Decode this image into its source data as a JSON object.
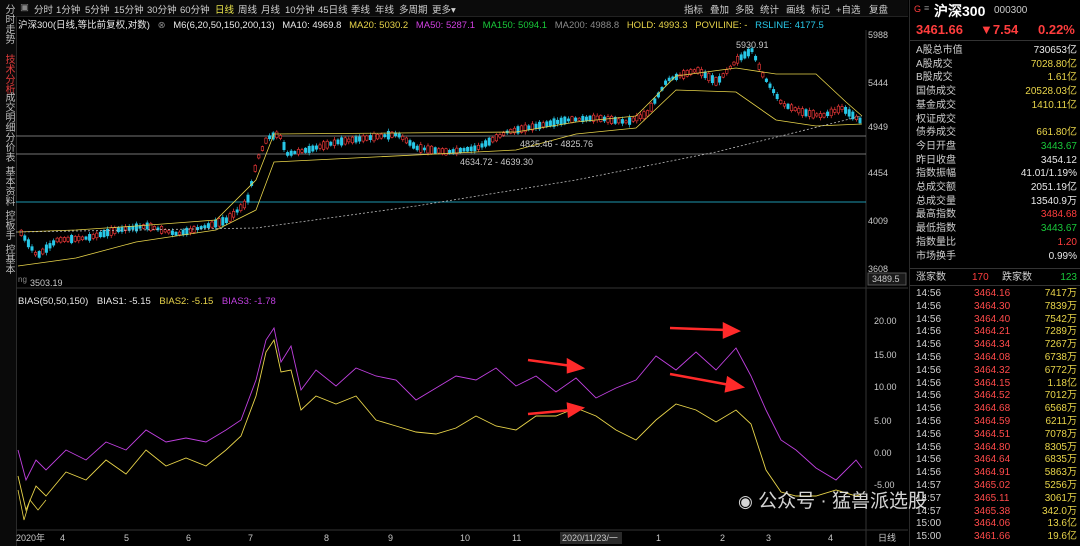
{
  "left_tabs": [
    {
      "label": "分时走势",
      "active": false
    },
    {
      "label": "技术分析",
      "active": true
    },
    {
      "label": "成交明细",
      "active": false
    },
    {
      "label": "分价表",
      "active": false
    },
    {
      "label": "基本资料",
      "active": false
    },
    {
      "label": "控板手",
      "active": false
    },
    {
      "label": "控基本",
      "active": false
    }
  ],
  "toolbar": {
    "periods": [
      "分时",
      "1分钟",
      "5分钟",
      "15分钟",
      "30分钟",
      "60分钟",
      "日线",
      "周线",
      "月线",
      "10分钟",
      "45日线",
      "季线",
      "年线",
      "多周期",
      "更多"
    ],
    "active_period": "日线",
    "right_tools": [
      "指标",
      "叠加",
      "多股",
      "统计",
      "画线",
      "标记",
      "+自选",
      "复盘"
    ]
  },
  "ma_line": {
    "title": "沪深300(日线,等比前复权,对数)",
    "m6": "M6(6,20,50,150,200,13)",
    "ma10": "MA10: 4969.8",
    "ma20": "MA20: 5030.2",
    "ma50": "MA50: 5287.1",
    "ma150": "MA150: 5094.1",
    "ma200": "MA200: 4988.8",
    "hold": "HOLD: 4993.3",
    "poviline": "POVILINE: -",
    "rsline": "RSLINE: 4177.5"
  },
  "bias_line": {
    "title": "BIAS(50,50,150)",
    "bias1": "BIAS1: -5.15",
    "bias2": "BIAS2: -5.15",
    "bias3": "BIAS3: -1.78"
  },
  "price_axis": [
    "5988",
    "5444",
    "4949",
    "4454",
    "4009",
    "3608"
  ],
  "bias_axis": [
    "20.00",
    "15.00",
    "10.00",
    "5.00",
    "0.00",
    "-5.00"
  ],
  "time_axis": [
    "2020年",
    "4",
    "5",
    "6",
    "7",
    "8",
    "9",
    "10",
    "11",
    "2020/11/23/一",
    "1",
    "2",
    "3",
    "4"
  ],
  "chart_labels": {
    "high": "5930.91",
    "low": "3503.19",
    "range1": "4825.46 - 4825.76",
    "range2": "4634.72 - 4639.30",
    "current": "3489.5",
    "period_tag": "日线",
    "axis_label": "ng"
  },
  "colors": {
    "up": "#ff3d3d",
    "down": "#19c93a",
    "bias2": "#e8d44a",
    "bias3": "#c040e0",
    "ma20": "#e8d44a",
    "cyan": "#28c8e8"
  },
  "quote": {
    "g": "G",
    "name": "沪深300",
    "code": "000300",
    "price": "3461.66",
    "change": "▼7.54",
    "pct": "0.22%"
  },
  "stats": [
    {
      "label": "A股总市值",
      "value": "730653亿",
      "cls": "white"
    },
    {
      "label": "A股成交",
      "value": "7028.80亿",
      "cls": "yellow"
    },
    {
      "label": "B股成交",
      "value": "1.61亿",
      "cls": "yellow"
    },
    {
      "label": "国债成交",
      "value": "20528.03亿",
      "cls": "yellow"
    },
    {
      "label": "基金成交",
      "value": "1410.11亿",
      "cls": "yellow"
    },
    {
      "label": "权证成交",
      "value": "",
      "cls": "yellow"
    },
    {
      "label": "债券成交",
      "value": "661.80亿",
      "cls": "yellow"
    },
    {
      "label": "今日开盘",
      "value": "3443.67",
      "cls": "green"
    },
    {
      "label": "昨日收盘",
      "value": "3454.12",
      "cls": "white"
    },
    {
      "label": "指数振幅",
      "value": "41.01/1.19%",
      "cls": "white"
    },
    {
      "label": "总成交额",
      "value": "2051.19亿",
      "cls": "white"
    },
    {
      "label": "总成交量",
      "value": "13540.9万",
      "cls": "white"
    },
    {
      "label": "最高指数",
      "value": "3484.68",
      "cls": "red"
    },
    {
      "label": "最低指数",
      "value": "3443.67",
      "cls": "green"
    },
    {
      "label": "指数量比",
      "value": "1.20",
      "cls": "red"
    },
    {
      "label": "市场换手",
      "value": "0.99%",
      "cls": "white"
    }
  ],
  "updown": {
    "up_label": "涨家数",
    "up": "170",
    "down_label": "跌家数",
    "down": "123"
  },
  "ticks": [
    {
      "t": "14:56",
      "p": "3464.16",
      "v": "7417万"
    },
    {
      "t": "14:56",
      "p": "3464.30",
      "v": "7839万"
    },
    {
      "t": "14:56",
      "p": "3464.40",
      "v": "7542万"
    },
    {
      "t": "14:56",
      "p": "3464.21",
      "v": "7289万"
    },
    {
      "t": "14:56",
      "p": "3464.34",
      "v": "7267万"
    },
    {
      "t": "14:56",
      "p": "3464.08",
      "v": "6738万"
    },
    {
      "t": "14:56",
      "p": "3464.32",
      "v": "6772万"
    },
    {
      "t": "14:56",
      "p": "3464.15",
      "v": "1.18亿"
    },
    {
      "t": "14:56",
      "p": "3464.52",
      "v": "7012万"
    },
    {
      "t": "14:56",
      "p": "3464.68",
      "v": "6568万"
    },
    {
      "t": "14:56",
      "p": "3464.59",
      "v": "6211万"
    },
    {
      "t": "14:56",
      "p": "3464.51",
      "v": "7078万"
    },
    {
      "t": "14:56",
      "p": "3464.80",
      "v": "8305万"
    },
    {
      "t": "14:56",
      "p": "3464.64",
      "v": "6835万"
    },
    {
      "t": "14:56",
      "p": "3464.91",
      "v": "5863万"
    },
    {
      "t": "14:57",
      "p": "3465.02",
      "v": "5256万"
    },
    {
      "t": "14:57",
      "p": "3465.11",
      "v": "3061万"
    },
    {
      "t": "14:57",
      "p": "3465.38",
      "v": "342.0万"
    },
    {
      "t": "15:00",
      "p": "3464.06",
      "v": "13.6亿"
    },
    {
      "t": "15:00",
      "p": "3461.66",
      "v": "19.6亿"
    }
  ],
  "watermark": "公众号 · 猛兽派选股"
}
